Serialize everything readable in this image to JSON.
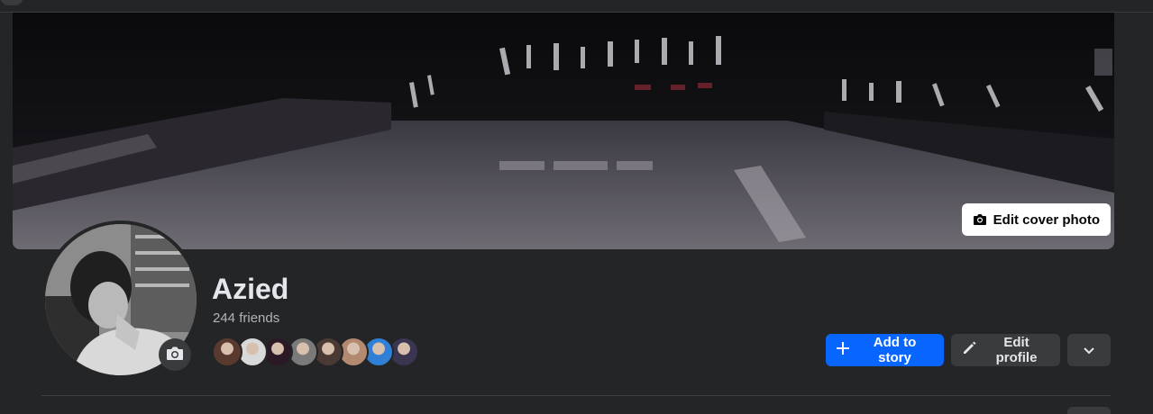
{
  "profile": {
    "name": "Azied",
    "friends_count": "244 friends"
  },
  "cover": {
    "edit_label": "Edit cover photo",
    "icon": "camera-icon"
  },
  "avatar": {
    "camera_icon": "camera-icon"
  },
  "friend_avatars": [
    {
      "name": "friend-1",
      "color": "#5a3a2e"
    },
    {
      "name": "friend-2",
      "color": "#d9d9d9"
    },
    {
      "name": "friend-3",
      "color": "#2b1a26"
    },
    {
      "name": "friend-4",
      "color": "#7a7a7a"
    },
    {
      "name": "friend-5",
      "color": "#4a3a33"
    },
    {
      "name": "friend-6",
      "color": "#b38a70"
    },
    {
      "name": "friend-7",
      "color": "#2f7fd6"
    },
    {
      "name": "friend-8",
      "color": "#3a3550"
    }
  ],
  "actions": {
    "add_story": "Add to story",
    "edit_profile": "Edit profile",
    "more_icon": "chevron-down-icon"
  },
  "colors": {
    "background": "#242526",
    "primary": "#0866ff",
    "secondary_button": "#3a3b3c",
    "text": "#e4e6eb",
    "muted_text": "#b0b3b8"
  }
}
